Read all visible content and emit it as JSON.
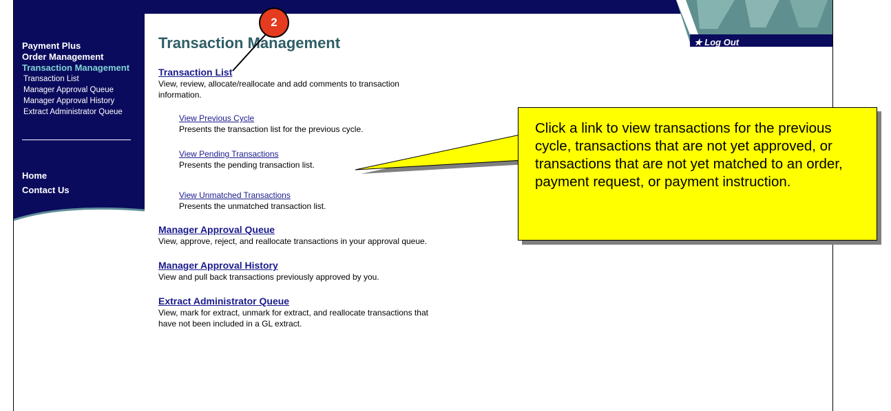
{
  "sidebar": {
    "top_items": [
      {
        "label": "Payment Plus"
      },
      {
        "label": "Order Management"
      },
      {
        "label": "Transaction Management"
      }
    ],
    "sub_items": [
      {
        "label": "Transaction List"
      },
      {
        "label": "Manager Approval Queue"
      },
      {
        "label": "Manager Approval History"
      },
      {
        "label": "Extract Administrator Queue"
      }
    ],
    "bottom_items": [
      {
        "label": "Home"
      },
      {
        "label": "Contact Us"
      }
    ]
  },
  "header": {
    "logout_label": "★ Log Out"
  },
  "main": {
    "title": "Transaction Management",
    "transaction_list": {
      "label": "Transaction List",
      "description": "View, review, allocate/reallocate and add comments to transaction information."
    },
    "sub_links": [
      {
        "label": "View Previous Cycle",
        "description": "Presents the transaction list for the previous cycle."
      },
      {
        "label": "View Pending Transactions",
        "description": "Presents the pending transaction list."
      },
      {
        "label": "View Unmatched Transactions",
        "description": "Presents the unmatched transaction list."
      }
    ],
    "sections": [
      {
        "label": "Manager Approval Queue",
        "description": "View, approve, reject, and reallocate transactions in your approval queue."
      },
      {
        "label": "Manager Approval History",
        "description": "View and pull back transactions previously approved by you."
      },
      {
        "label": "Extract Administrator Queue",
        "description": "View, mark for extract, unmark for extract, and reallocate transactions that have not been included in a GL extract."
      }
    ]
  },
  "annotation": {
    "step_number": "2",
    "callout_text": "Click a link to view transactions for the previous cycle, transactions that are not yet approved, or transactions that are not yet matched to an order, payment request, or payment instruction."
  },
  "colors": {
    "nav_background": "#0b0b5e",
    "active_nav": "#7fd4d4",
    "title_color": "#2e5e66",
    "link_color": "#1a1a8c",
    "callout_fill": "#ffff00",
    "badge_fill": "#e53b1f"
  }
}
